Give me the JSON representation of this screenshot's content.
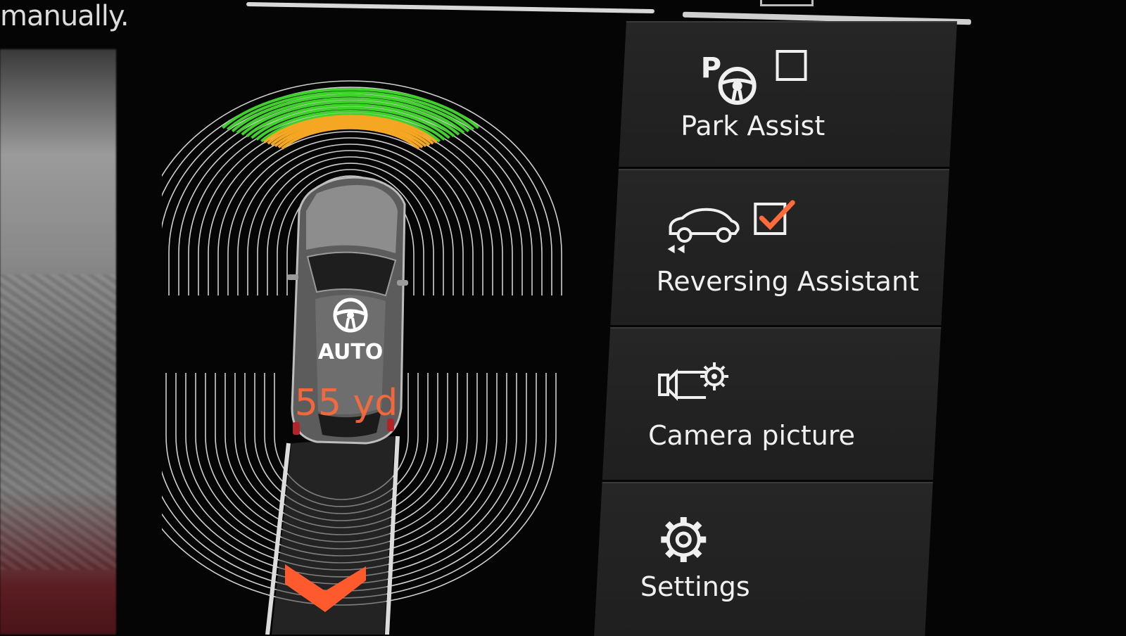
{
  "header": {
    "message": "manually."
  },
  "car_view": {
    "mode_label": "AUTO",
    "distance": "55 yd",
    "front_zones": [
      "green",
      "amber"
    ],
    "colors": {
      "green": "#3fd22a",
      "amber": "#f5a623",
      "distance": "#ff6a3a",
      "arrow": "#ff5a2e"
    }
  },
  "menu": {
    "items": [
      {
        "label": "Park Assist",
        "icon": "park-assist-icon",
        "checked": false
      },
      {
        "label": "Reversing Assistant",
        "icon": "reversing-car-icon",
        "checked": true
      },
      {
        "label": "Camera picture",
        "icon": "camera-settings-icon"
      },
      {
        "label": "Settings",
        "icon": "gear-icon"
      }
    ],
    "check_color": "#ff6a3a"
  }
}
